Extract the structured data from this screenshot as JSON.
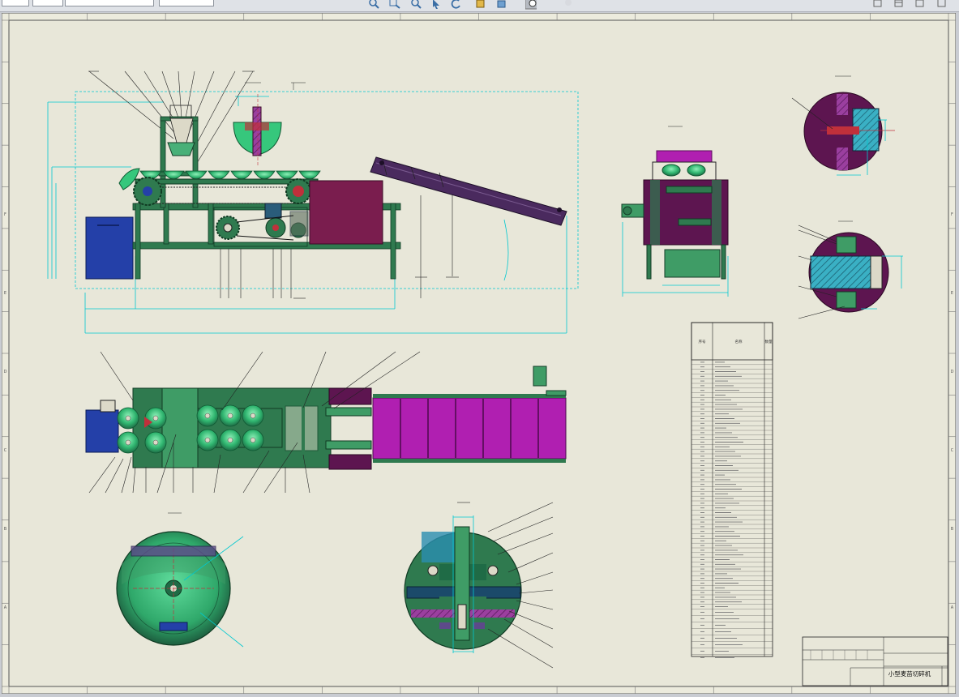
{
  "toolbar": {
    "field_1": "",
    "field_2": "",
    "field_3": "",
    "field_4": "",
    "icons": [
      "zoom-to-fit-icon",
      "zoom-area-icon",
      "zoom-in-out-icon",
      "select-icon",
      "rotate-icon",
      "section-view-icon",
      "display-style-icon",
      "view-orientation-icon",
      "hide-show-icon"
    ],
    "window_icons": [
      "restore-icon",
      "tile-icon",
      "close-icon"
    ]
  },
  "drawing": {
    "title_block_name": "小型麦苗切碎机",
    "bom_header": {
      "col_no": "序号",
      "col_name": "名称",
      "col_qty": "数量"
    },
    "zone_letters_left": [
      "F",
      "E",
      "D",
      "C",
      "B",
      "A"
    ],
    "colors": {
      "sheet_bg": "#e8e7d9",
      "frame": "#6b6b6b",
      "dark_green": "#2f6e4a",
      "green": "#3f9c66",
      "bright_green": "#36c77c",
      "magenta": "#a21ea3",
      "purple": "#7a1d6b",
      "hopper_purple": "#4a2a5e",
      "blue": "#2440a8",
      "cyan": "#00c8d0",
      "hatch": "#2a8fb0",
      "red": "#c0303b"
    }
  }
}
